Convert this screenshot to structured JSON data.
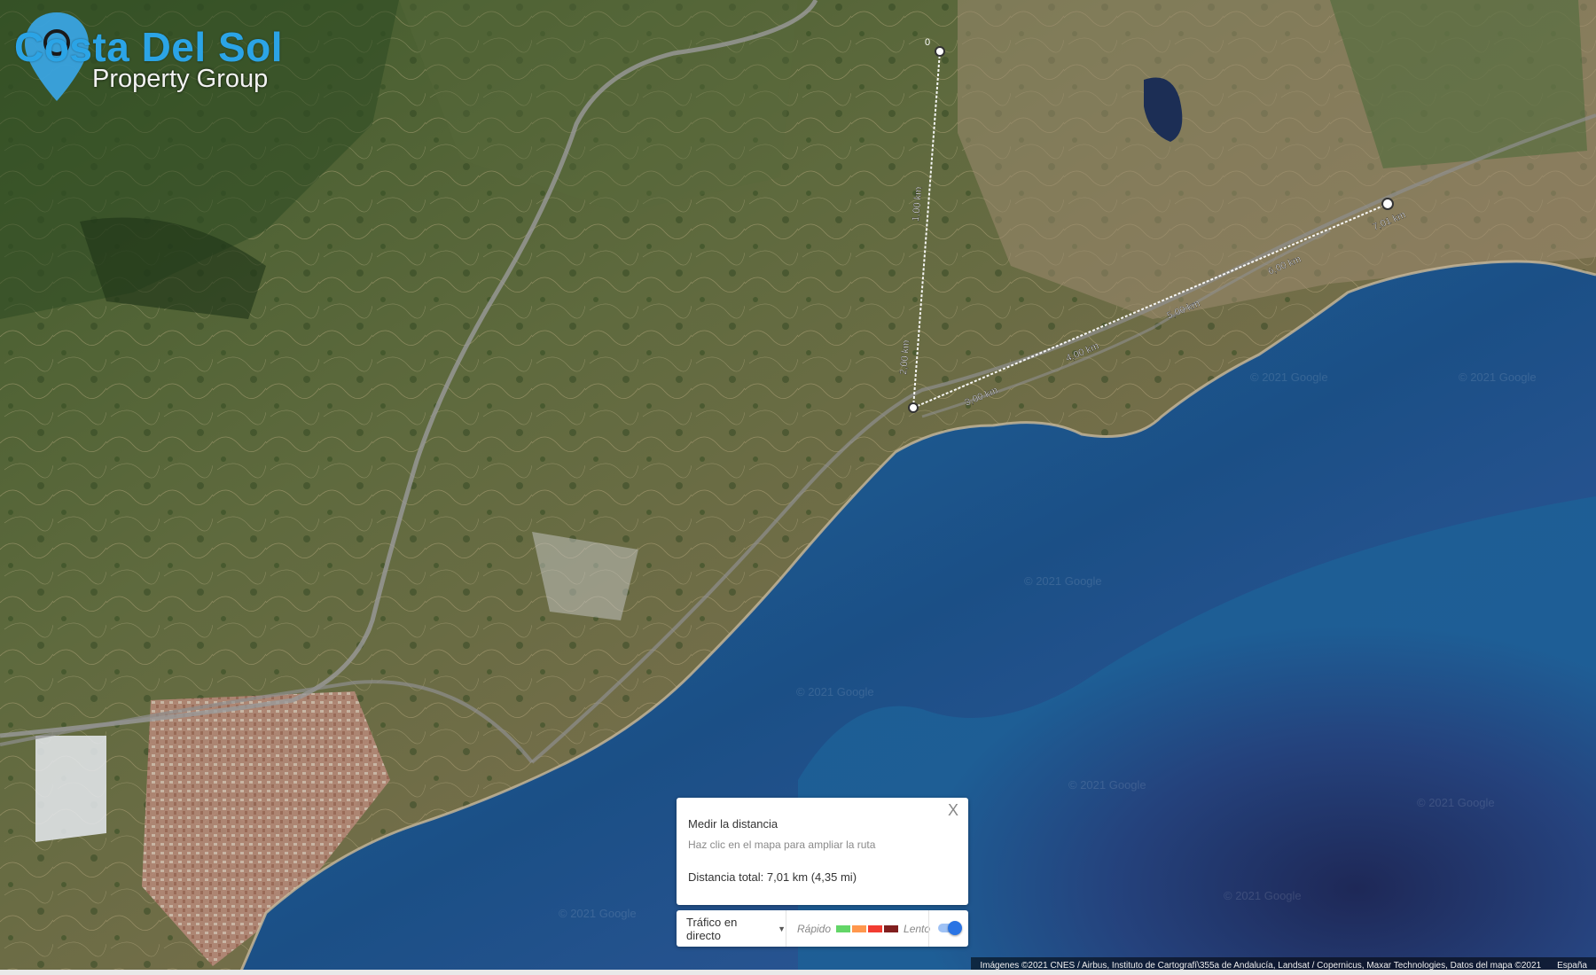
{
  "brand": {
    "title": "Costa Del Sol",
    "subtitle": "Property Group"
  },
  "measure": {
    "title": "Medir la distancia",
    "hint": "Haz clic en el mapa para ampliar la ruta",
    "total": "Distancia total: 7,01 km (4,35 mi)",
    "close_label": "X"
  },
  "route_labels": [
    "1,00 km",
    "2,00 km",
    "3,00 km",
    "4,00 km",
    "5,00 km",
    "6,00 km",
    "7,01 km"
  ],
  "traffic": {
    "live_label": "Tráfico en directo",
    "fast_label": "Rápido",
    "slow_label": "Lento",
    "colors": [
      "#63d668",
      "#ff974d",
      "#f23c32",
      "#811f1f"
    ],
    "toggle_on": true
  },
  "attribution": {
    "text": "Imágenes ©2021 CNES / Airbus, Instituto de Cartografí\\355a de Andalucía, Landsat / Copernicus, Maxar Technologies, Datos del mapa ©2021",
    "country": "España"
  },
  "watermarks": [
    "© 2021 Google",
    "© 2021 Google",
    "© 2021 Google",
    "© 2021 Google",
    "© 2021 Google",
    "© 2021 Google",
    "© 2021 Google",
    "© 2021 Google"
  ]
}
